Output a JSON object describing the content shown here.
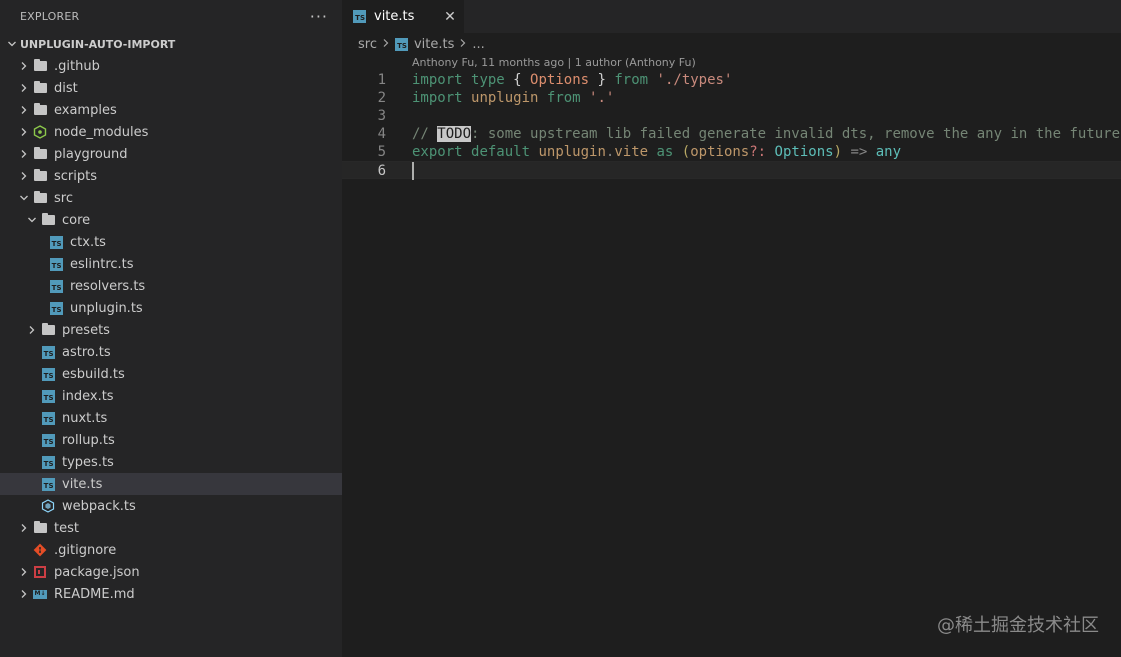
{
  "sidebar": {
    "title": "EXPLORER",
    "more": "···",
    "project": "UNPLUGIN-AUTO-IMPORT",
    "items": [
      {
        "label": ".github",
        "kind": "folder",
        "depth": 0,
        "open": false
      },
      {
        "label": "dist",
        "kind": "folder",
        "depth": 0,
        "open": false
      },
      {
        "label": "examples",
        "kind": "folder",
        "depth": 0,
        "open": false
      },
      {
        "label": "node_modules",
        "kind": "node",
        "depth": 0,
        "open": false
      },
      {
        "label": "playground",
        "kind": "folder",
        "depth": 0,
        "open": false
      },
      {
        "label": "scripts",
        "kind": "folder",
        "depth": 0,
        "open": false
      },
      {
        "label": "src",
        "kind": "folder",
        "depth": 0,
        "open": true
      },
      {
        "label": "core",
        "kind": "folder",
        "depth": 1,
        "open": true
      },
      {
        "label": "ctx.ts",
        "kind": "ts",
        "depth": 2
      },
      {
        "label": "eslintrc.ts",
        "kind": "ts",
        "depth": 2
      },
      {
        "label": "resolvers.ts",
        "kind": "ts",
        "depth": 2
      },
      {
        "label": "unplugin.ts",
        "kind": "ts",
        "depth": 2
      },
      {
        "label": "presets",
        "kind": "folder",
        "depth": 1,
        "open": false
      },
      {
        "label": "astro.ts",
        "kind": "ts",
        "depth": 1
      },
      {
        "label": "esbuild.ts",
        "kind": "ts",
        "depth": 1
      },
      {
        "label": "index.ts",
        "kind": "ts",
        "depth": 1
      },
      {
        "label": "nuxt.ts",
        "kind": "ts",
        "depth": 1
      },
      {
        "label": "rollup.ts",
        "kind": "ts",
        "depth": 1
      },
      {
        "label": "types.ts",
        "kind": "ts",
        "depth": 1
      },
      {
        "label": "vite.ts",
        "kind": "ts",
        "depth": 1,
        "selected": true
      },
      {
        "label": "webpack.ts",
        "kind": "webpack",
        "depth": 1
      },
      {
        "label": "test",
        "kind": "folder",
        "depth": 0,
        "open": false
      },
      {
        "label": ".gitignore",
        "kind": "git",
        "depth": 0
      },
      {
        "label": "package.json",
        "kind": "json",
        "depth": 0,
        "open": false
      },
      {
        "label": "README.md",
        "kind": "md",
        "depth": 0,
        "open": false
      }
    ]
  },
  "editor": {
    "tab_label": "vite.ts",
    "tab_close": "✕",
    "ts_badge": "TS",
    "md_badge": "M↓",
    "breadcrumb": {
      "folder": "src",
      "file": "vite.ts",
      "more": "..."
    },
    "codelens": "Anthony Fu, 11 months ago | 1 author (Anthony Fu)",
    "line_numbers": [
      "1",
      "2",
      "3",
      "4",
      "5",
      "6"
    ],
    "code": {
      "l1": {
        "import": "import",
        "type": "type",
        "open": "{",
        "name": "Options",
        "close": "}",
        "from": "from",
        "path": "'./types'"
      },
      "l2": {
        "import": "import",
        "name": "unplugin",
        "from": "from",
        "path": "'.'"
      },
      "l4": {
        "slashes": "// ",
        "todo": "TODO",
        "rest": ": some upstream lib failed generate invalid dts, remove the any in the future"
      },
      "l5": {
        "export": "export",
        "default": "default",
        "obj": "unplugin",
        "dot": ".",
        "prop": "vite",
        "as": "as",
        "lparen": "(",
        "param": "options",
        "q": "?:",
        "ptype": "Options",
        "rparen": ")",
        "arrow": "=>",
        "any": "any"
      }
    }
  },
  "watermark": "@稀土掘金技术社区",
  "colors": {
    "ts_icon": "#519aba",
    "json_icon": "#cc3e44",
    "git_icon": "#e44d26",
    "node_icon": "#8cc84b",
    "webpack_icon": "#8ed6fb",
    "selected_row": "#37373d"
  }
}
